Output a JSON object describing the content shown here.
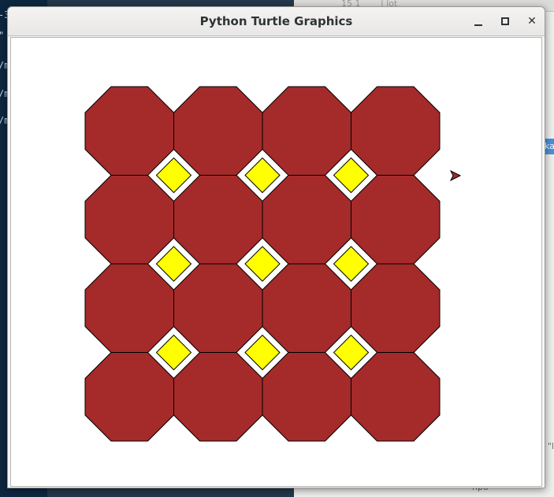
{
  "window": {
    "title": "Python Turtle Graphics",
    "controls": {
      "minimize_icon": "minimize-icon",
      "maximize_icon": "maximize-icon",
      "close_icon": "close-icon",
      "close_label": "✕"
    }
  },
  "background": {
    "terminal_lines": [
      "-3",
      "\"",
      "/m",
      "/m",
      "/m"
    ],
    "editor_tab_fragments": [
      "15  1",
      "|  lot"
    ],
    "editor_side_fragment": "ka",
    "editor_status_fragment": "\"l",
    "editor_bottom_fragment": "npo"
  },
  "canvas": {
    "background": "#ffffff",
    "drawing": {
      "rows": 4,
      "cols": 4,
      "octagon_fill": "#a52a2a",
      "square_fill": "#ffff00",
      "outline": "#000000"
    },
    "turtle": {
      "shape": "classic-arrow",
      "heading_deg": 0,
      "fill": "#a52a2a",
      "icon": "turtle-cursor-icon"
    }
  }
}
